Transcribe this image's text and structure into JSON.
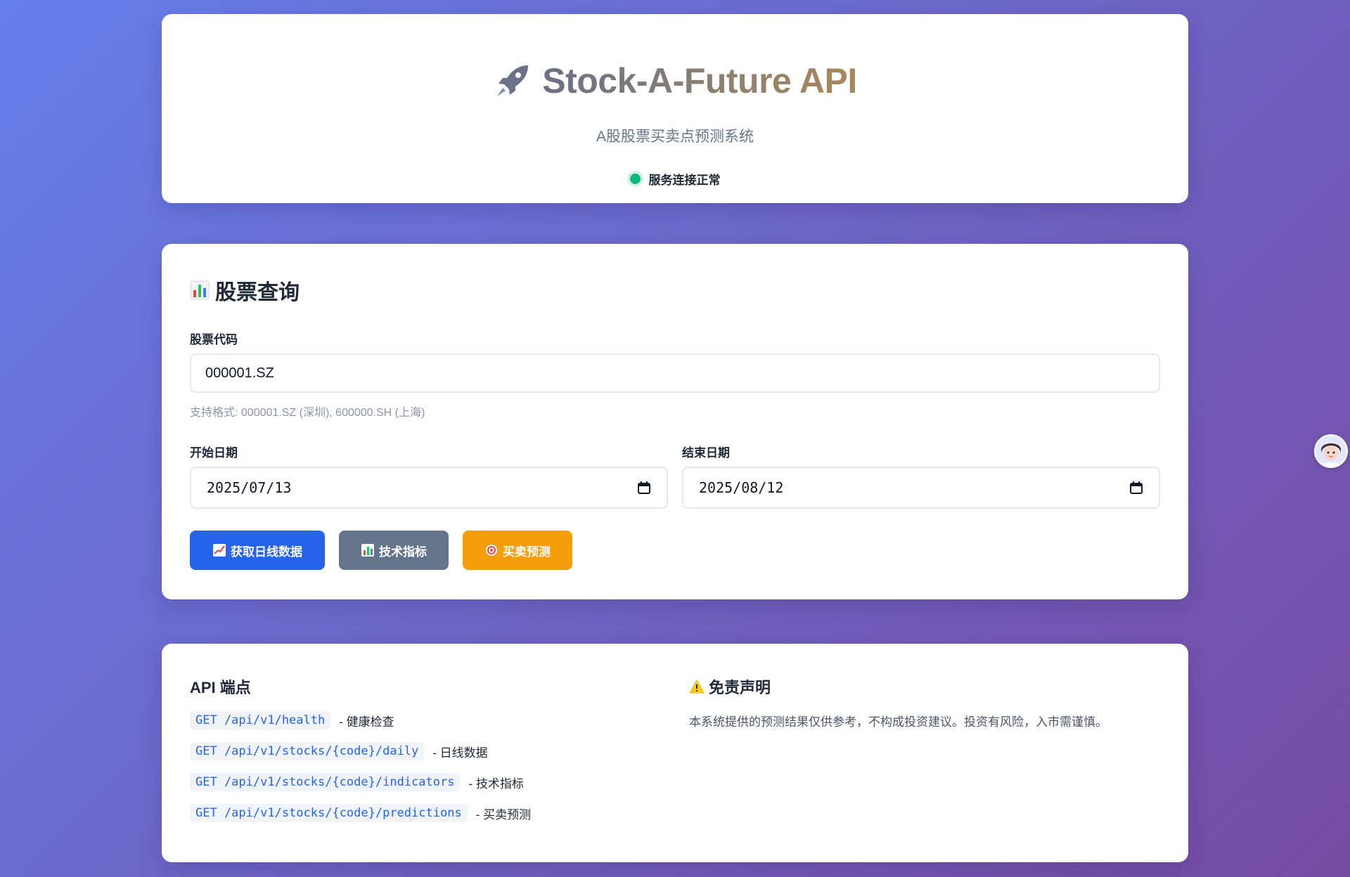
{
  "header": {
    "title": "Stock-A-Future API",
    "subtitle": "A股股票买卖点预测系统",
    "status_text": "服务连接正常",
    "status_color": "#10b981"
  },
  "query": {
    "section_title": "股票查询",
    "code_label": "股票代码",
    "code_value": "000001.SZ",
    "code_hint": "支持格式: 000001.SZ (深圳), 600000.SH (上海)",
    "start_label": "开始日期",
    "start_value": "2025/07/13",
    "end_label": "结束日期",
    "end_value": "2025/08/12",
    "buttons": {
      "daily": "获取日线数据",
      "indicators": "技术指标",
      "predictions": "买卖预测"
    }
  },
  "api": {
    "heading": "API 端点",
    "endpoints": [
      {
        "code": "GET /api/v1/health",
        "desc": "- 健康检查"
      },
      {
        "code": "GET /api/v1/stocks/{code}/daily",
        "desc": "- 日线数据"
      },
      {
        "code": "GET /api/v1/stocks/{code}/indicators",
        "desc": "- 技术指标"
      },
      {
        "code": "GET /api/v1/stocks/{code}/predictions",
        "desc": "- 买卖预测"
      }
    ],
    "disclaimer_heading": "免责声明",
    "disclaimer_text": "本系统提供的预测结果仅供参考，不构成投资建议。投资有风险，入市需谨慎。"
  },
  "colors": {
    "primary": "#2563eb",
    "secondary": "#64748b",
    "accent": "#f59e0b"
  }
}
